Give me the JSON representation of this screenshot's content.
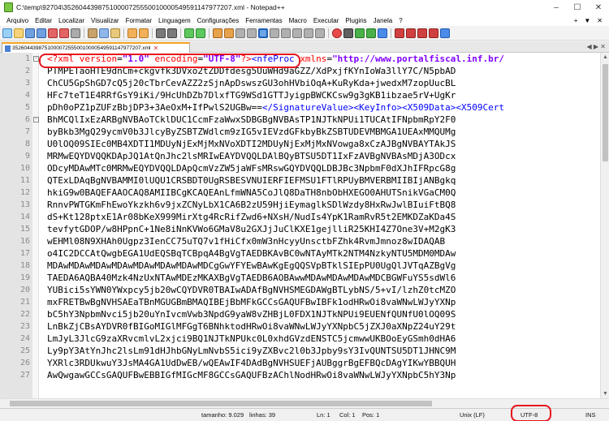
{
  "window": {
    "title": "C:\\temp\\92704\\35260443987510000725550010000549591147977207.xml - Notepad++",
    "minimize": "–",
    "maximize": "☐",
    "close": "✕"
  },
  "menu": {
    "items": [
      "Arquivo",
      "Editar",
      "Localizar",
      "Visualizar",
      "Formatar",
      "Linguagem",
      "Configurações",
      "Ferramentas",
      "Macro",
      "Executar",
      "Plugins",
      "Janela",
      "?"
    ],
    "right": [
      "+",
      "▼",
      "✕"
    ]
  },
  "tab": {
    "label": "35260443987510000725550010000549591147977207.xml",
    "close": "✕",
    "arrows": "◀ ▶ ✕"
  },
  "editor": {
    "lines": [
      {
        "n": "1",
        "fold": "minus",
        "segments": [
          {
            "t": "<?xml ",
            "c": "c-pi"
          },
          {
            "t": "version",
            "c": "c-attr"
          },
          {
            "t": "=",
            "c": ""
          },
          {
            "t": "\"1.0\"",
            "c": "c-val"
          },
          {
            "t": " encoding",
            "c": "c-attr"
          },
          {
            "t": "=",
            "c": ""
          },
          {
            "t": "\"UTF-8\"",
            "c": "c-val"
          },
          {
            "t": "?>",
            "c": "c-pi"
          },
          {
            "t": "<nfeProc ",
            "c": "c-tag"
          },
          {
            "t": "xmlns",
            "c": "c-attr"
          },
          {
            "t": "=",
            "c": ""
          },
          {
            "t": "\"http://www.portalfiscal.inf.br/",
            "c": "c-val"
          }
        ]
      },
      {
        "n": "2",
        "segments": [
          {
            "t": "PTMPETaoHTE9dnCm+ckgvfk3DVxo2tZDDfdesg5UuWHd9aGZZ/XdPxjfKYnIoWa3llY7C/N5pbAD",
            "c": ""
          }
        ]
      },
      {
        "n": "3",
        "segments": [
          {
            "t": "ChCU5GpShGD7cQ5j20cTbrCevAZZ2zSjnApDswszGU3ohHVbiOqA+KuRyKda+jwedxM7zopUucBL",
            "c": ""
          }
        ]
      },
      {
        "n": "4",
        "segments": [
          {
            "t": "HFc7teT1E4RRfGsY9iKi/9HcUhDZb7DlxfTG9WSd1GTTJyigpBWCKCsw9g3gKB1ibzae5rV+UgKr",
            "c": ""
          }
        ]
      },
      {
        "n": "5",
        "segments": [
          {
            "t": "pDh0oPZ1pZUFzBbjDP3+3AeOxM+IfPwlS2UGBw==",
            "c": ""
          },
          {
            "t": "</SignatureValue>",
            "c": "c-blue"
          },
          {
            "t": "<KeyInfo>",
            "c": "c-blue"
          },
          {
            "t": "<X509Data>",
            "c": "c-blue"
          },
          {
            "t": "<X509Cert",
            "c": "c-blue"
          }
        ]
      },
      {
        "n": "6",
        "fold": "minus",
        "segments": [
          {
            "t": "BhMCQlIxEzARBgNVBAoTCklDUC1CcmFzaWwxSDBGBgNVBAsTP1NJTkNPUi1TUCAtIFNpbmRpY2F0",
            "c": ""
          }
        ]
      },
      {
        "n": "7",
        "segments": [
          {
            "t": "byBkb3MgQ29ycmV0b3JlcyByZSBTZWdlcm9zIG5vIEVzdGFkbyBkZSBTUDEVMBMGA1UEAxMMQUMg",
            "c": ""
          }
        ]
      },
      {
        "n": "8",
        "segments": [
          {
            "t": "U0lOQ09SIEc0MB4XDTI1MDUyNjExMjMxNVoXDTI2MDUyNjExMjMxNVowga8xCzAJBgNVBAYTAkJS",
            "c": ""
          }
        ]
      },
      {
        "n": "9",
        "segments": [
          {
            "t": "MRMwEQYDVQQKDApJQ1AtQnJhc2lsMRIwEAYDVQQLDAlBQyBTSU5DT1IxFzAVBgNVBAsMDjA3ODcx",
            "c": ""
          }
        ]
      },
      {
        "n": "10",
        "segments": [
          {
            "t": "ODcyMDAwMTc0MRMwEQYDVQQLDApQcmVzZW5jaWFsMRswGQYDVQQLDBJBc3NpbmF0dXJhIFRpcG8g",
            "c": ""
          }
        ]
      },
      {
        "n": "11",
        "segments": [
          {
            "t": "QTExLDAqBgNVBAMMI0lUQU1CRSBDT0UgRSBESVNUIERFIEFMSU1FTlRPUyBMVERBMIIBIjANBgkq",
            "c": ""
          }
        ]
      },
      {
        "n": "12",
        "segments": [
          {
            "t": "hkiG9w0BAQEFAAOCAQ8AMIIBCgKCAQEAnLfmWNA5CoJlQ8DaTH8nbObHXEGO0AHUTSnikVGaCM0Q",
            "c": ""
          }
        ]
      },
      {
        "n": "13",
        "segments": [
          {
            "t": "RnnvPWTGKmFhEwoYkzkh6v9jxZCNyLbX1CA6B2zU59HjiEymaglkSDlWzdy8HxRwJwlBIuiFtBQ8",
            "c": ""
          }
        ]
      },
      {
        "n": "14",
        "segments": [
          {
            "t": "dS+Kt128ptxE1Ar08bKeX999MirXtg4RcRifZwd6+NXsH/NudIs4YpK1RamRvR5t2EMKDZaKDa4S",
            "c": ""
          }
        ]
      },
      {
        "n": "15",
        "segments": [
          {
            "t": "tevfytGDOP/w8HPpnC+1Ne8iNnKVWo6GMaV8u2GXJjJuClKXE1gejlliR25KHI4Z7One3V+M2gK3",
            "c": ""
          }
        ]
      },
      {
        "n": "16",
        "segments": [
          {
            "t": "wEHMl08N9XHAh0Ugpz3IenCC75uTQ7v1fHiCfx0mW3nHcyyUnsctbFZhk4RvmJmnoz8wIDAQAB",
            "c": ""
          }
        ]
      },
      {
        "n": "17",
        "segments": [
          {
            "t": "o4IC2DCCAtQwgbEGA1UdEQSBqTCBpqA4BgVgTAEDBKAvBC0wNTAyMTk2NTM4NzkyNTU5MDM0MDAw",
            "c": ""
          }
        ]
      },
      {
        "n": "18",
        "segments": [
          {
            "t": "MDAwMDAwMDAwMDAwMDAwMDAwMDAwMDCgGwYFYEwBAwKgEgQQSVpBTklSIEpPU0UgQlJVTqAZBgVg",
            "c": ""
          }
        ]
      },
      {
        "n": "19",
        "segments": [
          {
            "t": "TAEDA6AQBA40Mzk4NzUxNTAwMDEzMKAXBgVgTAEDB6AOBAwwMDAwMDAwMDAwMDCBGWFuYS5sdWl6",
            "c": ""
          }
        ]
      },
      {
        "n": "20",
        "segments": [
          {
            "t": "YUBici5sYWN0YWxpcy5jb20wCQYDVR0TBAIwADAfBgNVHSMEGDAWgBTLybNS/5+vI/lzhZ0tcMZO",
            "c": ""
          }
        ]
      },
      {
        "n": "21",
        "segments": [
          {
            "t": "mxFRETBwBgNVHSAEaTBnMGUGBmBMAQIBEjBbMFkGCCsGAQUFBwIBFk1odHRwOi8vaWNwLWJyYXNp",
            "c": ""
          }
        ]
      },
      {
        "n": "22",
        "segments": [
          {
            "t": "bC5hY3NpbmNvci5jb20uYnIvcmVwb3NpdG9yaW8vZHBjL0FDX1NJTkNPUi9EUENfQUNfU0lOQ09S",
            "c": ""
          }
        ]
      },
      {
        "n": "23",
        "segments": [
          {
            "t": "LnBkZjCBsAYDVR0fBIGoMIGlMFGgT6BNhktodHRwOi8vaWNwLWJyYXNpbC5jZXJ0aXNpZ24uY29t",
            "c": ""
          }
        ]
      },
      {
        "n": "24",
        "segments": [
          {
            "t": "LmJyL3JlcG9zaXRvcmlvL2xjci9BQ1NJTkNPUkc0L0xhdGVzdENSTC5jcmwwUKBOoEyGSmh0dHA6",
            "c": ""
          }
        ]
      },
      {
        "n": "25",
        "segments": [
          {
            "t": "Ly9pY3AtYnJhc2lsLm91dHJhbGNyLmNvbS5ici9yZXBvc2l0b3Jpby9sY3IvQUNTSU5DT1JHNC9M",
            "c": ""
          }
        ]
      },
      {
        "n": "26",
        "segments": [
          {
            "t": "YXRlc3RDUkwuY3JsMA4GA1UdDwEB/wQEAwIF4DAdBgNVHSUEFjAUBggrBgEFBQcDAgYIKwYBBQUH",
            "c": ""
          }
        ]
      },
      {
        "n": "27",
        "segments": [
          {
            "t": "AwQwgawGCCsGAQUFBwEBBIGfMIGcMF8GCCsGAQUFBzAChlNodHRwOi8vaWNwLWJyYXNpbC5hY3Np",
            "c": ""
          }
        ]
      }
    ]
  },
  "status": {
    "size": "tamanho: 9.029",
    "lines": "linhas: 39",
    "ln": "Ln: 1",
    "col": "Col: 1",
    "pos": "Pos: 1",
    "eol": "Unix (LF)",
    "encoding": "UTF-8",
    "mode": "INS"
  },
  "colors": {
    "highlight": "#e8141c",
    "tag": "#0000ff",
    "attribute": "#ff0000",
    "value": "#8000ff"
  }
}
